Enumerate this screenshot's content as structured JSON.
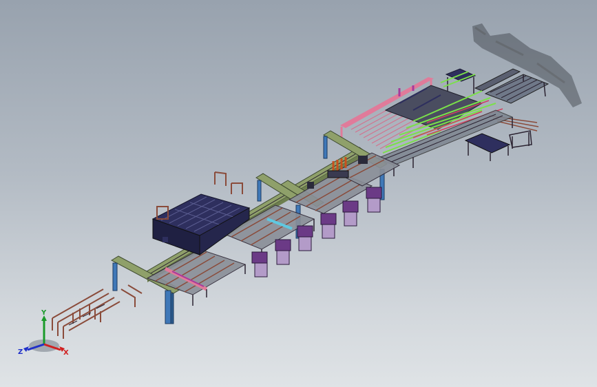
{
  "viewport": {
    "background_top": "#98a2ae",
    "background_bottom": "#dfe3e6"
  },
  "model": {
    "kind": "3D assembly - automated production line (isometric view)",
    "colors": {
      "beam_green": "#8fa06a",
      "column_blue": "#3f78b8",
      "pink_frame": "#e07b9a",
      "magenta_part": "#a63a9c",
      "purple_motor": "#6b3a86",
      "bright_green": "#7be04a",
      "cyan_part": "#5fc8e0",
      "navy_rack": "#2e2f5e",
      "brown_conveyor": "#8a4b3a",
      "dark_line": "#2a2230"
    }
  },
  "triad": {
    "x_label": "X",
    "y_label": "Y",
    "z_label": "Z",
    "x_color": "#d02020",
    "y_color": "#1a9a2a",
    "z_color": "#2030c8"
  }
}
